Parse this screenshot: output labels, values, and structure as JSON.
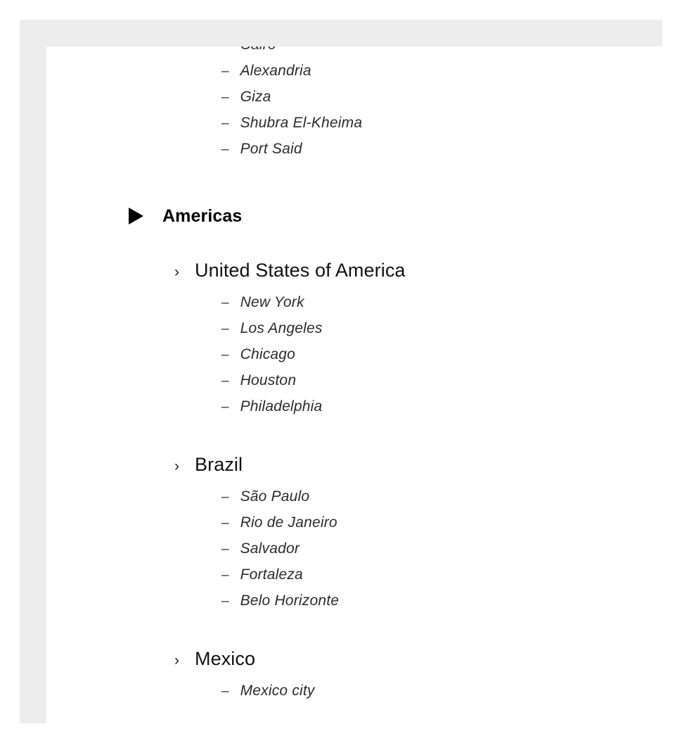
{
  "document": {
    "type": "outline",
    "markers": {
      "region": "filled-right-triangle",
      "country": "chevron-right",
      "city": "en-dash"
    },
    "marker_glyphs": {
      "country": "›",
      "city": "–"
    },
    "colors": {
      "page_background": "#ffffff",
      "frame": "#ededed",
      "region_text": "#000000",
      "country_text": "#111111",
      "city_text": "#2b2b2b",
      "marker": "#000000"
    }
  },
  "outline": {
    "leading_cities": [
      {
        "name": "Cairo"
      },
      {
        "name": "Alexandria"
      },
      {
        "name": "Giza"
      },
      {
        "name": "Shubra El-Kheima"
      },
      {
        "name": "Port Said"
      }
    ],
    "regions": [
      {
        "label": "Americas",
        "countries": [
          {
            "label": "United States of America",
            "cities": [
              {
                "name": "New York"
              },
              {
                "name": "Los Angeles"
              },
              {
                "name": "Chicago"
              },
              {
                "name": "Houston"
              },
              {
                "name": "Philadelphia"
              }
            ]
          },
          {
            "label": "Brazil",
            "cities": [
              {
                "name": "São Paulo"
              },
              {
                "name": "Rio de Janeiro"
              },
              {
                "name": "Salvador"
              },
              {
                "name": "Fortaleza"
              },
              {
                "name": "Belo Horizonte"
              }
            ]
          },
          {
            "label": "Mexico",
            "cities": [
              {
                "name": "Mexico city"
              }
            ]
          }
        ]
      }
    ]
  }
}
